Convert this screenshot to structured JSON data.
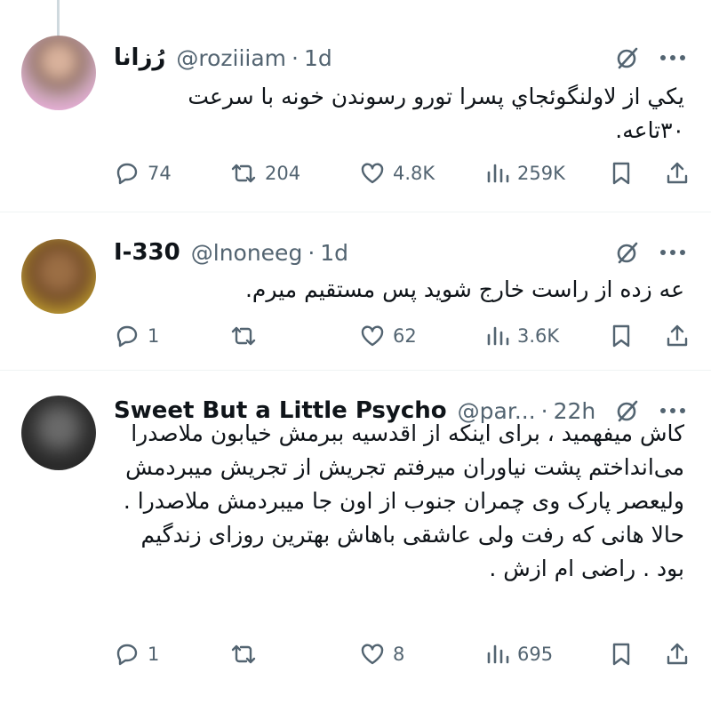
{
  "tweets": [
    {
      "name": "رُزانا",
      "handle": "@roziiiam",
      "time": "1d",
      "text": "يكي از لاولنگوئجاي پسرا تورو رسوندن خونه با سرعت ۳۰تاعه.",
      "replies": "74",
      "retweets": "204",
      "likes": "4.8K",
      "views": "259K"
    },
    {
      "name": "I-330",
      "handle": "@lnoneeg",
      "time": "1d",
      "text": "عه زده از راست خارج شوید پس مستقیم میرم.",
      "replies": "1",
      "retweets": "",
      "likes": "62",
      "views": "3.6K"
    },
    {
      "name": "Sweet But a Little Psycho",
      "handle": "@par...",
      "time": "22h",
      "text": "کاش میفهمید ، برای اینکه از اقدسیه ببرمش خیابون ملاصدرا می‌انداختم پشت نیاوران میرفتم تجریش از تجریش میبردمش ولیعصر پارک وی چمران جنوب از اون جا میبردمش ملاصدرا . حالا هانی که رفت ولی عاشقی باهاش بهترین روزای زندگیم بود . راضی ام ازش .",
      "replies": "1",
      "retweets": "",
      "likes": "8",
      "views": "695"
    }
  ],
  "icons": {
    "grok": "grok-icon",
    "more": "more-icon",
    "reply": "reply-icon",
    "retweet": "retweet-icon",
    "like": "heart-icon",
    "views": "views-icon",
    "bookmark": "bookmark-icon",
    "share": "share-icon"
  },
  "colors": {
    "text": "#0f1419",
    "secondary": "#536471",
    "divider": "#eff3f4",
    "thread_line": "#cfd9de"
  }
}
